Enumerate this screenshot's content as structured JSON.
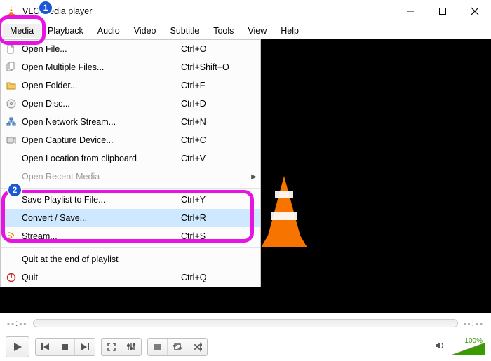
{
  "title": "VLC media player",
  "menubar": {
    "items": [
      {
        "label": "Media",
        "selected": true
      },
      {
        "label": "Playback"
      },
      {
        "label": "Audio"
      },
      {
        "label": "Video"
      },
      {
        "label": "Subtitle"
      },
      {
        "label": "Tools"
      },
      {
        "label": "View"
      },
      {
        "label": "Help"
      }
    ]
  },
  "dropdown": {
    "items": [
      {
        "label": "Open File...",
        "shortcut": "Ctrl+O",
        "icon": "file"
      },
      {
        "label": "Open Multiple Files...",
        "shortcut": "Ctrl+Shift+O",
        "icon": "files"
      },
      {
        "label": "Open Folder...",
        "shortcut": "Ctrl+F",
        "icon": "folder"
      },
      {
        "label": "Open Disc...",
        "shortcut": "Ctrl+D",
        "icon": "disc"
      },
      {
        "label": "Open Network Stream...",
        "shortcut": "Ctrl+N",
        "icon": "network"
      },
      {
        "label": "Open Capture Device...",
        "shortcut": "Ctrl+C",
        "icon": "capture"
      },
      {
        "label": "Open Location from clipboard",
        "shortcut": "Ctrl+V",
        "icon": ""
      },
      {
        "label": "Open Recent Media",
        "shortcut": "",
        "icon": "",
        "submenu": true,
        "disabled": true
      },
      {
        "sep": true
      },
      {
        "label": "Save Playlist to File...",
        "shortcut": "Ctrl+Y",
        "icon": ""
      },
      {
        "label": "Convert / Save...",
        "shortcut": "Ctrl+R",
        "icon": "",
        "highlight": true
      },
      {
        "label": "Stream...",
        "shortcut": "Ctrl+S",
        "icon": "stream"
      },
      {
        "sep": true
      },
      {
        "label": "Quit at the end of playlist",
        "shortcut": "",
        "icon": ""
      },
      {
        "label": "Quit",
        "shortcut": "Ctrl+Q",
        "icon": "quit"
      }
    ]
  },
  "seek": {
    "time": "--:--"
  },
  "volume": {
    "pct": "100%"
  },
  "annotations": {
    "badge1": "1",
    "badge2": "2"
  }
}
